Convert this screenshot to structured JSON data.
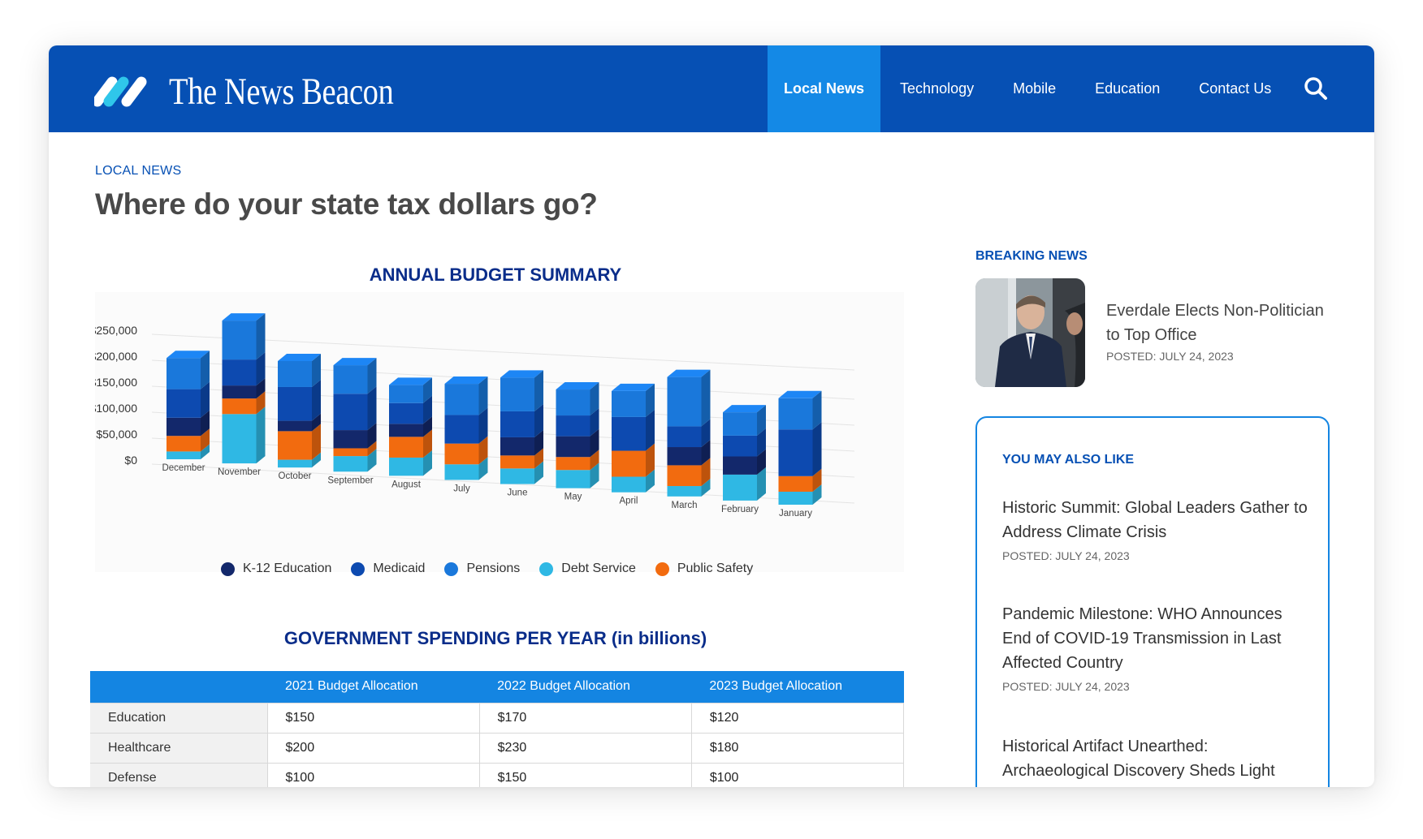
{
  "site": {
    "name": "The News Beacon",
    "logo_icon": "double-slash-logo-icon",
    "brand_color": "#0650b4",
    "active_color": "#1489e6"
  },
  "nav": {
    "items": [
      "Local News",
      "Technology",
      "Mobile",
      "Education",
      "Contact Us"
    ],
    "active": "Local News",
    "search_icon": "search-icon"
  },
  "article": {
    "kicker": "LOCAL NEWS",
    "headline": "Where do your state tax dollars go?"
  },
  "chart_data": {
    "type": "bar",
    "stacked": true,
    "three_d": true,
    "title": "ANNUAL BUDGET SUMMARY",
    "categories": [
      "December",
      "November",
      "October",
      "September",
      "August",
      "July",
      "June",
      "May",
      "April",
      "March",
      "February",
      "January"
    ],
    "yticks": [
      "$250,000",
      "$200,000",
      "$150,000",
      "$100,000",
      "$50,000",
      "$0"
    ],
    "ylim": [
      0,
      250000
    ],
    "legend_position": "bottom",
    "series": [
      {
        "name": "Debt Service",
        "color": "#2fb8e4",
        "values": [
          15000,
          95000,
          15000,
          30000,
          35000,
          30000,
          30000,
          35000,
          30000,
          20000,
          50000,
          25000
        ]
      },
      {
        "name": "Public Safety",
        "color": "#f26b0f",
        "values": [
          30000,
          30000,
          55000,
          15000,
          40000,
          40000,
          25000,
          25000,
          50000,
          40000,
          0,
          30000
        ]
      },
      {
        "name": "K-12 Education",
        "color": "#13286b",
        "values": [
          35000,
          25000,
          20000,
          35000,
          25000,
          0,
          35000,
          40000,
          0,
          35000,
          35000,
          0
        ]
      },
      {
        "name": "Medicaid",
        "color": "#0d4ab0",
        "values": [
          55000,
          50000,
          65000,
          70000,
          40000,
          55000,
          50000,
          40000,
          65000,
          40000,
          40000,
          90000
        ]
      },
      {
        "name": "Pensions",
        "color": "#1a78db",
        "values": [
          60000,
          75000,
          50000,
          55000,
          35000,
          60000,
          65000,
          50000,
          50000,
          95000,
          45000,
          60000
        ]
      }
    ],
    "legend_order": [
      "K-12 Education",
      "Medicaid",
      "Pensions",
      "Debt Service",
      "Public Safety"
    ],
    "legend_colors": [
      "#13286b",
      "#0d4ab0",
      "#1a78db",
      "#2fb8e4",
      "#f26b0f"
    ]
  },
  "spending_table": {
    "title": "GOVERNMENT SPENDING PER YEAR (in billions)",
    "headers": [
      "",
      "2021 Budget Allocation",
      "2022 Budget Allocation",
      "2023 Budget Allocation"
    ],
    "rows": [
      [
        "Education",
        "$150",
        "$170",
        "$120"
      ],
      [
        "Healthcare",
        "$200",
        "$230",
        "$180"
      ],
      [
        "Defense",
        "$100",
        "$150",
        "$100"
      ]
    ]
  },
  "breaking": {
    "label": "BREAKING NEWS",
    "title": "Everdale Elects Non-Politician to Top Office",
    "date": "POSTED: JULY 24, 2023"
  },
  "also_like": {
    "label": "YOU MAY ALSO LIKE",
    "items": [
      {
        "title": "Historic Summit: Global Leaders Gather to Address Climate Crisis",
        "date": "POSTED: JULY 24, 2023"
      },
      {
        "title": "Pandemic Milestone: WHO Announces End of COVID-19 Transmission in Last Affected Country",
        "date": "POSTED: JULY 24, 2023"
      },
      {
        "title": "Historical Artifact Unearthed: Archaeological Discovery Sheds Light",
        "date": ""
      }
    ]
  }
}
